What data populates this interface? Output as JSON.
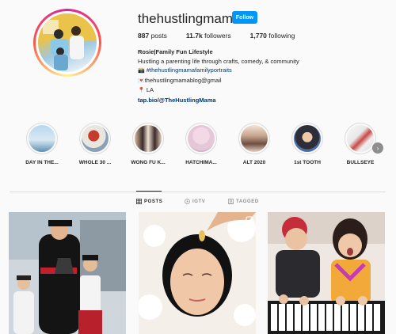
{
  "profile": {
    "username": "thehustlingmama",
    "follow_label": "Follow",
    "stats": [
      {
        "value": "887",
        "label": "posts"
      },
      {
        "value": "11.7k",
        "label": "followers"
      },
      {
        "value": "1,770",
        "label": "following"
      }
    ],
    "bio": {
      "name": "Rosie|Family Fun Lifestyle",
      "line1": "Hustling a parenting life through crafts, comedy, & community",
      "hashtag_prefix": "📸",
      "hashtag": "#thehustlingmamafamilyportraits",
      "email_prefix": "💌",
      "email": "thehustlingmamablog@gmail",
      "location_prefix": "📍",
      "location": "LA",
      "link": "tap.bio/@TheHustlingMama"
    }
  },
  "highlights": [
    {
      "label": "DAY IN THE..."
    },
    {
      "label": "WHOLE 30 ..."
    },
    {
      "label": "WONG FU K..."
    },
    {
      "label": "HATCHIMA..."
    },
    {
      "label": "ALT 2020"
    },
    {
      "label": "1st TOOTH"
    },
    {
      "label": "BULLSEYE"
    }
  ],
  "tabs": [
    {
      "label": "POSTS",
      "icon": "grid-icon"
    },
    {
      "label": "IGTV",
      "icon": "igtv-icon"
    },
    {
      "label": "TAGGED",
      "icon": "tag-icon"
    }
  ],
  "colors": {
    "follow_blue": "#0095f6",
    "link_blue": "#00376b"
  }
}
